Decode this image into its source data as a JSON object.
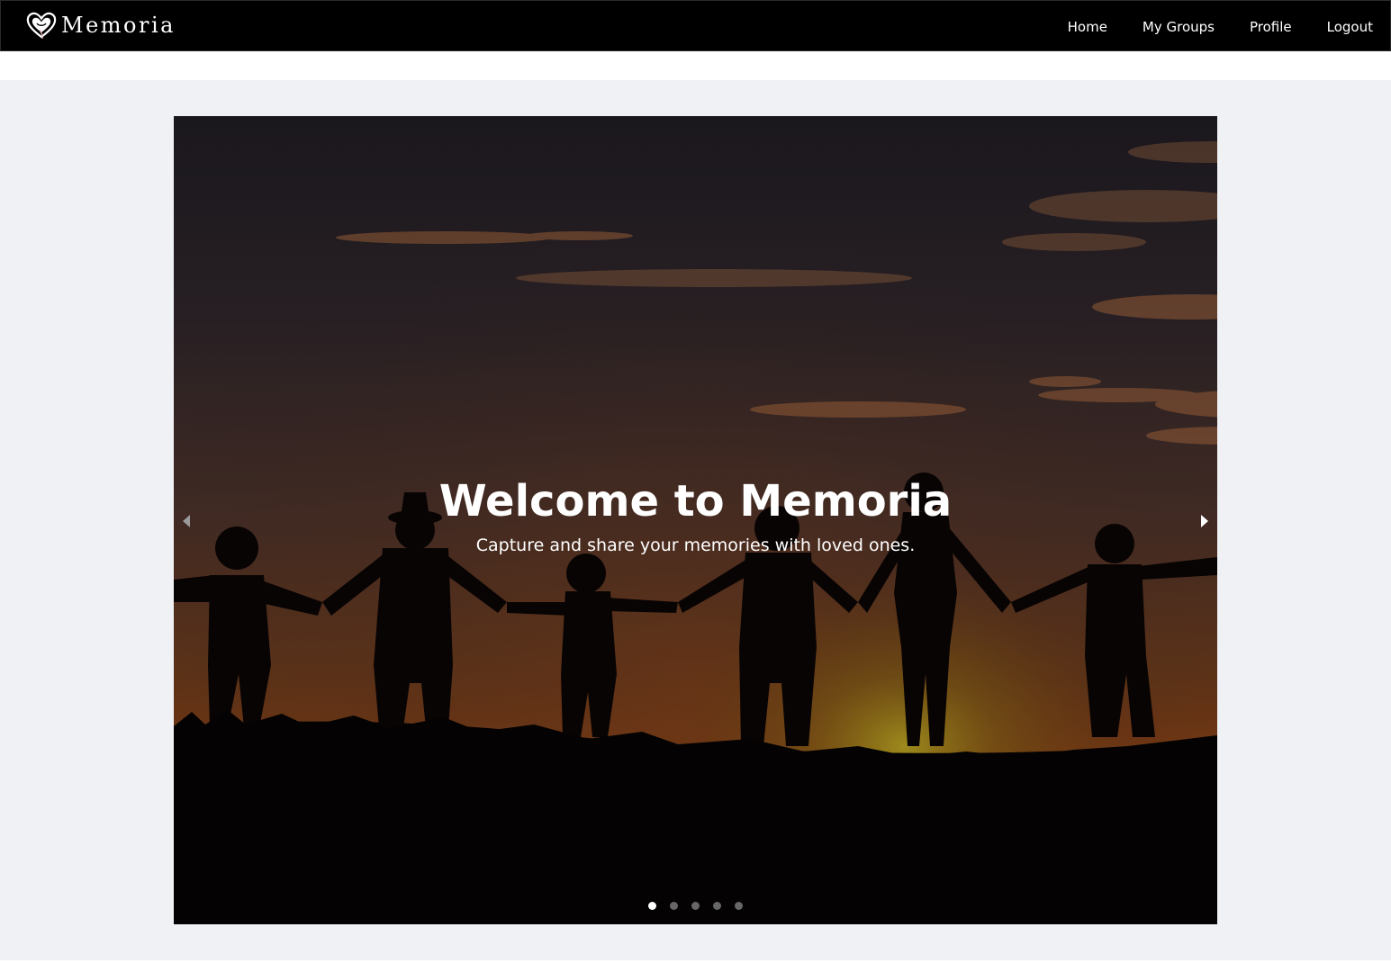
{
  "brand": {
    "name": "Memoria",
    "logo_icon": "heart-logo-icon",
    "color": "#ffffff"
  },
  "nav": {
    "items": [
      {
        "label": "Home"
      },
      {
        "label": "My Groups"
      },
      {
        "label": "Profile"
      },
      {
        "label": "Logout"
      }
    ],
    "background": "#000000"
  },
  "carousel": {
    "slide_image": "silhouettes-holding-hands-sunset",
    "title": "Welcome to Memoria",
    "subtitle": "Capture and share your memories with loved ones.",
    "prev_icon": "chevron-left-icon",
    "next_icon": "chevron-right-icon",
    "slide_count": 5,
    "active_slide": 1
  },
  "colors": {
    "page_background": "#f0f1f5",
    "navbar": "#000000",
    "text_on_dark": "#ffffff"
  }
}
